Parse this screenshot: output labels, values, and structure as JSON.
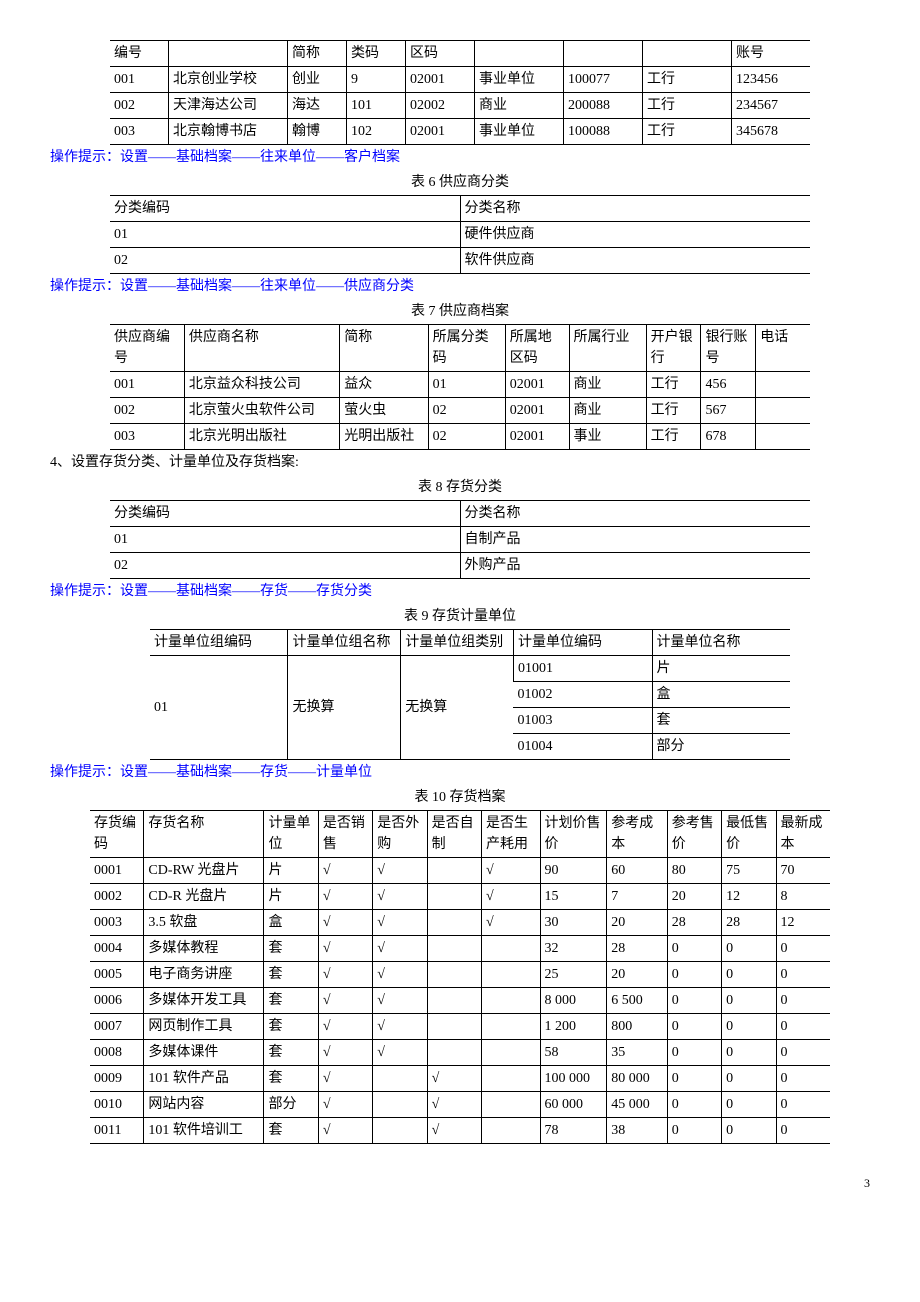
{
  "table5": {
    "headers": [
      "编号",
      "",
      "简称",
      "类码",
      "区码",
      "",
      "",
      "",
      "账号"
    ],
    "rows": [
      [
        "001",
        "北京创业学校",
        "创业",
        "9",
        "02001",
        "事业单位",
        "100077",
        "工行",
        "123456"
      ],
      [
        "002",
        "天津海达公司",
        "海达",
        "101",
        "02002",
        "商业",
        "200088",
        "工行",
        "234567"
      ],
      [
        "003",
        "北京翰博书店",
        "翰博",
        "102",
        "02001",
        "事业单位",
        "100088",
        "工行",
        "345678"
      ]
    ]
  },
  "hint1": "操作提示：设置——基础档案——往来单位——客户档案",
  "cap6": "表 6 供应商分类",
  "table6": {
    "headers": [
      "分类编码",
      "分类名称"
    ],
    "rows": [
      [
        "01",
        "硬件供应商"
      ],
      [
        "02",
        "软件供应商"
      ]
    ]
  },
  "hint2": "操作提示：设置——基础档案——往来单位——供应商分类",
  "cap7": "表 7 供应商档案",
  "table7": {
    "headers": [
      "供应商编号",
      "供应商名称",
      "简称",
      "所属分类码",
      "所属地区码",
      "所属行业",
      "开户银行",
      "银行账号",
      "电话"
    ],
    "rows": [
      [
        "001",
        "北京益众科技公司",
        "益众",
        "01",
        "02001",
        "商业",
        "工行",
        "456",
        ""
      ],
      [
        "002",
        "北京萤火虫软件公司",
        "萤火虫",
        "02",
        "02001",
        "商业",
        "工行",
        "567",
        ""
      ],
      [
        "003",
        "北京光明出版社",
        "光明出版社",
        "02",
        "02001",
        "事业",
        "工行",
        "678",
        ""
      ]
    ]
  },
  "section4": "4、设置存货分类、计量单位及存货档案:",
  "cap8": "表 8 存货分类",
  "table8": {
    "headers": [
      "分类编码",
      "分类名称"
    ],
    "rows": [
      [
        "01",
        "自制产品"
      ],
      [
        "02",
        "外购产品"
      ]
    ]
  },
  "hint3": "操作提示：设置——基础档案——存货——存货分类",
  "cap9": "表 9 存货计量单位",
  "table9": {
    "headers": [
      "计量单位组编码",
      "计量单位组名称",
      "计量单位组类别",
      "计量单位编码",
      "计量单位名称"
    ],
    "group": {
      "code": "01",
      "name": "无换算",
      "type": "无换算"
    },
    "units": [
      [
        "01001",
        "片"
      ],
      [
        "01002",
        "盒"
      ],
      [
        "01003",
        "套"
      ],
      [
        "01004",
        "部分"
      ]
    ]
  },
  "hint4": "操作提示：设置——基础档案——存货——计量单位",
  "cap10": "表 10 存货档案",
  "table10": {
    "headers": [
      "存货编码",
      "存货名称",
      "计量单位",
      "是否销售",
      "是否外购",
      "是否自制",
      "是否生产耗用",
      "计划价售价",
      "参考成本",
      "参考售价",
      "最低售价",
      "最新成本"
    ],
    "rows": [
      [
        "0001",
        "CD-RW 光盘片",
        "片",
        "√",
        "√",
        "",
        "√",
        "90",
        "60",
        "80",
        "75",
        "70"
      ],
      [
        "0002",
        "CD-R 光盘片",
        "片",
        "√",
        "√",
        "",
        "√",
        "15",
        "7",
        "20",
        "12",
        "8"
      ],
      [
        "0003",
        "3.5 软盘",
        "盒",
        "√",
        "√",
        "",
        "√",
        "30",
        "20",
        "28",
        "28",
        "12"
      ],
      [
        "0004",
        "多媒体教程",
        "套",
        "√",
        "√",
        "",
        "",
        "32",
        "28",
        "0",
        "0",
        "0"
      ],
      [
        "0005",
        "电子商务讲座",
        "套",
        "√",
        "√",
        "",
        "",
        "25",
        "20",
        "0",
        "0",
        "0"
      ],
      [
        "0006",
        "多媒体开发工具",
        "套",
        "√",
        "√",
        "",
        "",
        "8 000",
        "6 500",
        "0",
        "0",
        "0"
      ],
      [
        "0007",
        "网页制作工具",
        "套",
        "√",
        "√",
        "",
        "",
        "1 200",
        "800",
        "0",
        "0",
        "0"
      ],
      [
        "0008",
        "多媒体课件",
        "套",
        "√",
        "√",
        "",
        "",
        "58",
        "35",
        "0",
        "0",
        "0"
      ],
      [
        "0009",
        "101 软件产品",
        "套",
        "√",
        "",
        "√",
        "",
        "100 000",
        "80 000",
        "0",
        "0",
        "0"
      ],
      [
        "0010",
        "网站内容",
        "部分",
        "√",
        "",
        "√",
        "",
        "60 000",
        "45 000",
        "0",
        "0",
        "0"
      ],
      [
        "0011",
        "101 软件培训工",
        "套",
        "√",
        "",
        "√",
        "",
        "78",
        "38",
        "0",
        "0",
        "0"
      ]
    ]
  },
  "pagenum": "3"
}
